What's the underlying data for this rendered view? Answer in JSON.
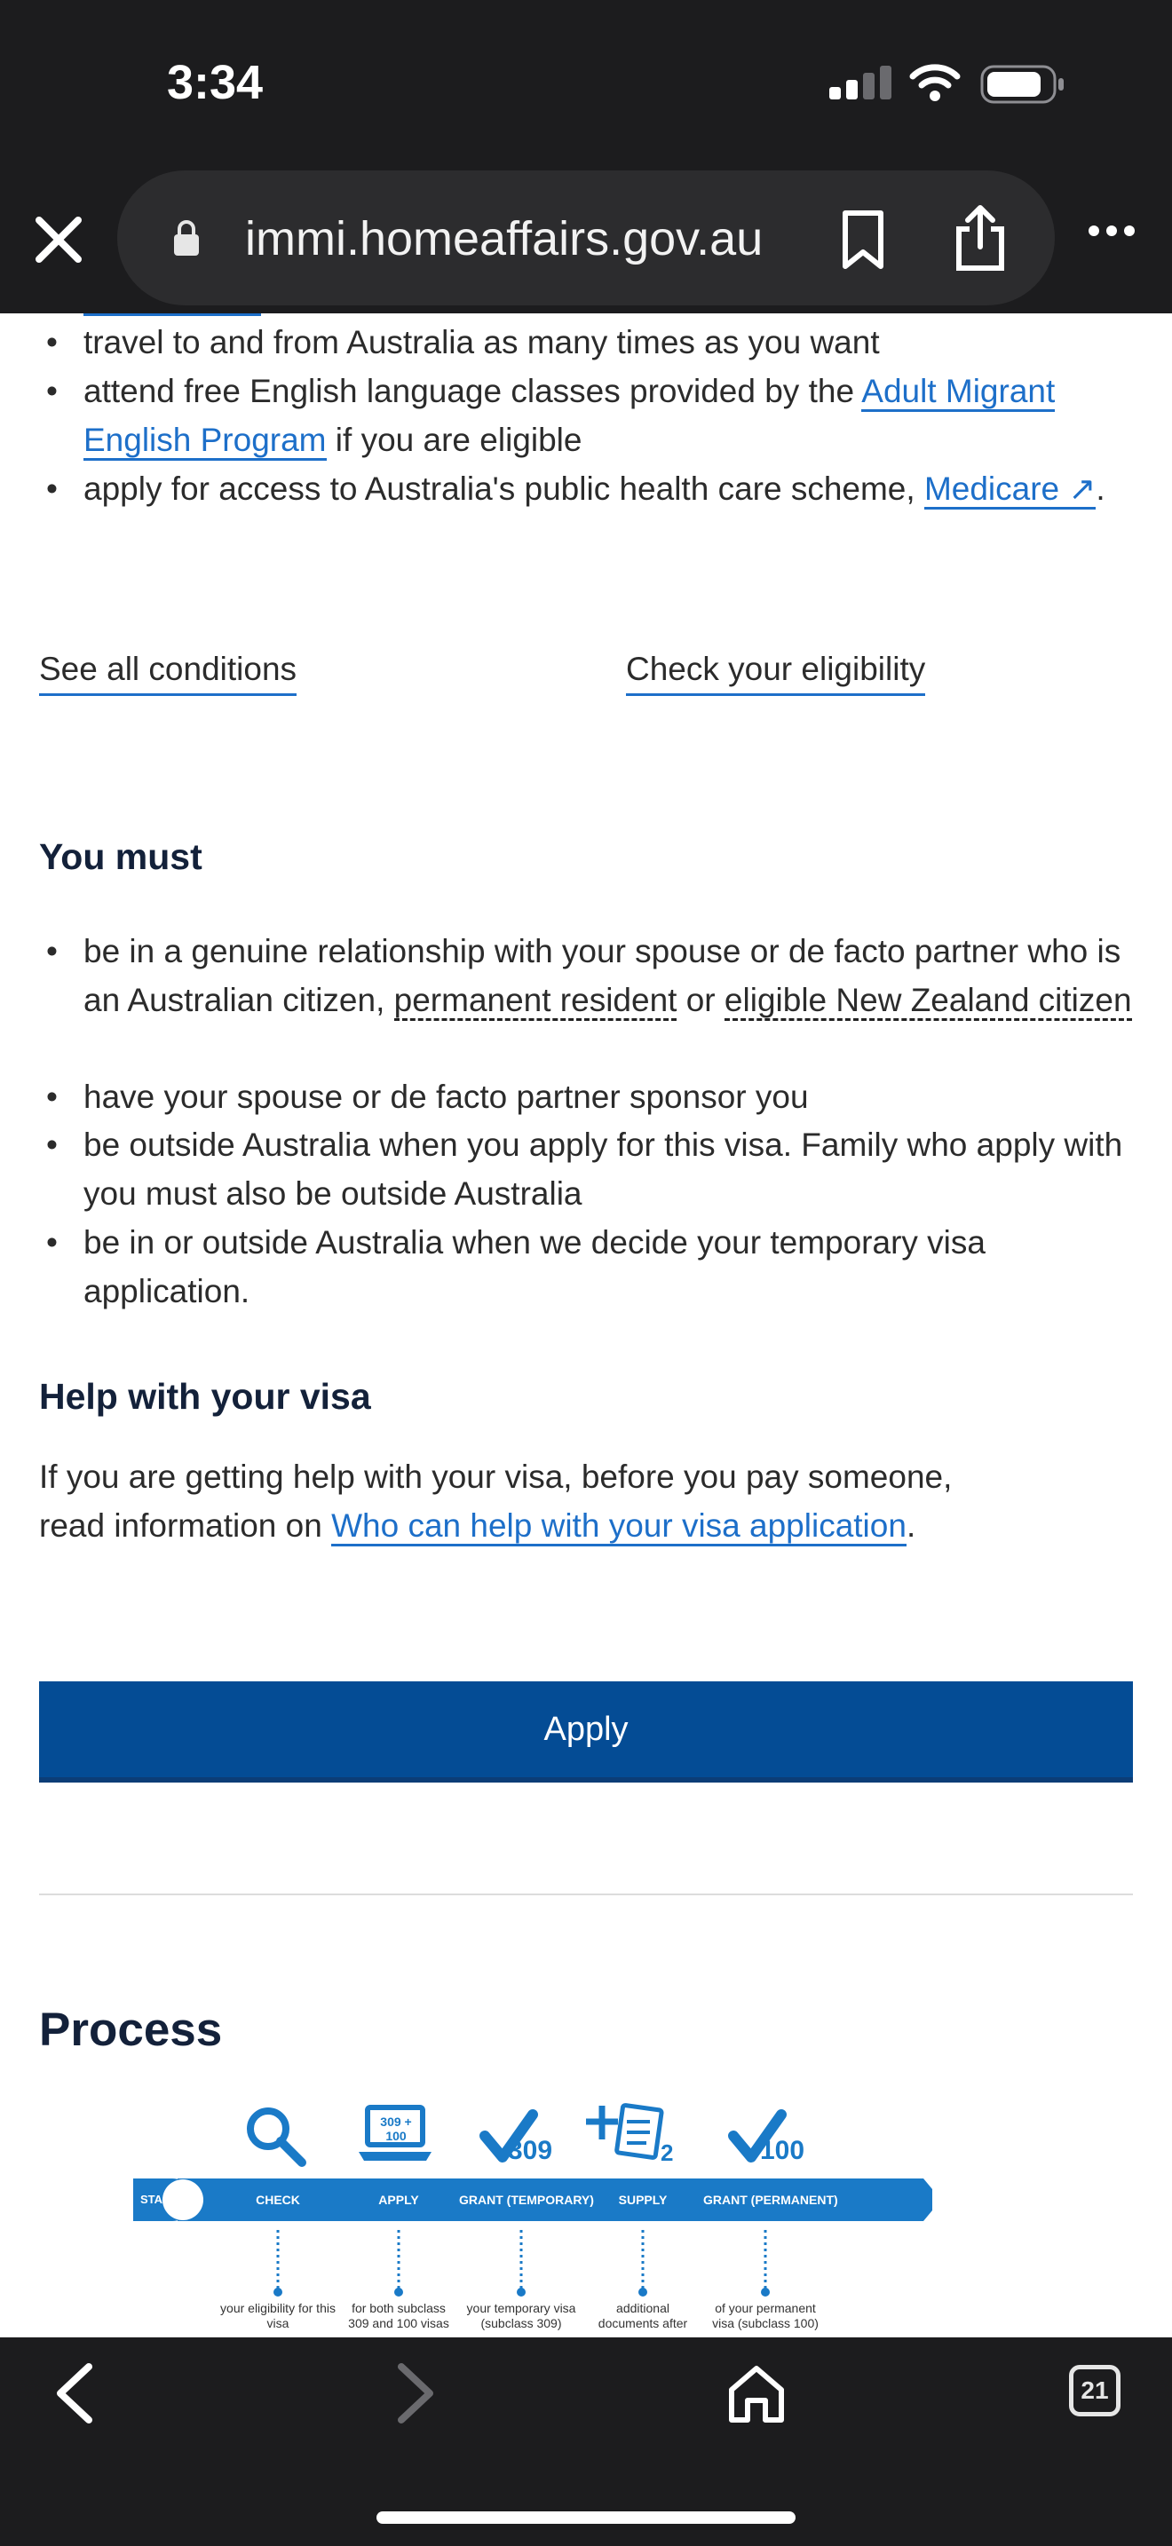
{
  "status_bar": {
    "time": "3:34"
  },
  "browser": {
    "url": "immi.homeaffairs.gov.au",
    "tab_count": "21"
  },
  "benefits": [
    {
      "parts": [
        "travel to and from Australia as many times as you want"
      ]
    },
    {
      "before": "attend free English language classes provided by the ",
      "link": "Adult Migrant English Program",
      "after": " if you are eligible"
    },
    {
      "before": "apply for access to Australia's public health care scheme, ",
      "link": "Medicare ↗",
      "after": "."
    }
  ],
  "links": {
    "see_all_conditions": "See all conditions",
    "check_eligibility": "Check your eligibility"
  },
  "you_must": {
    "heading": "You must",
    "item1_before": "be in a genuine relationship with your spouse or de facto partner who is an Australian citizen, ",
    "item1_term1": "permanent resident",
    "item1_mid": " or ",
    "item1_term2": "eligible New Zealand citizen",
    "item2": "have your spouse or de facto partner sponsor you",
    "item3": "be outside Australia when you apply for this visa. Family who apply with you must also be outside Australia",
    "item4": "be in or outside Australia when we decide your temporary visa application."
  },
  "help": {
    "heading": "Help with your visa",
    "before": "If you are getting help with your visa, before you pay someone, read information on ",
    "link": "Who can help with your visa application",
    "after": "."
  },
  "apply_label": "Apply",
  "process": {
    "title": "Process",
    "start": "START",
    "stages": [
      "CHECK",
      "APPLY",
      "GRANT (TEMPORARY)",
      "SUPPLY",
      "GRANT (PERMANENT)"
    ],
    "notes": [
      "your eligibility for this visa",
      "for both subclass 309 and 100 visas",
      "your temporary visa (subclass 309)",
      "additional documents after",
      "of your permanent visa (subclass 100)"
    ],
    "icon_309": "309",
    "icon_apply": "309 + 100",
    "icon_supply": "2",
    "icon_100": "100"
  },
  "colors": {
    "link": "#1d6fc9",
    "button": "#044c95",
    "heading": "#13213a",
    "diagram_blue": "#1a7ac7"
  }
}
